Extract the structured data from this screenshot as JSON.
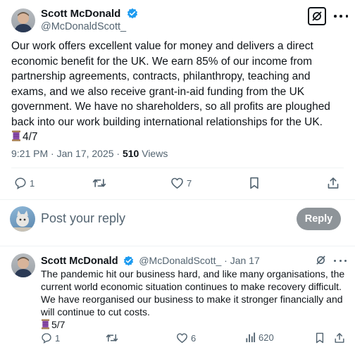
{
  "tweet": {
    "author_name": "Scott McDonald",
    "author_handle": "@McDonaldScott_",
    "body": "Our work offers excellent value for money and delivers a direct economic benefit for the UK. We earn 85% of our income from partnership agreements, contracts, philanthropy, teaching and exams, and we also receive grant-in-aid funding from the UK government. We have no shareholders, so all profits are ploughed back into our work building international relationships for the UK.",
    "thread_counter": "4/7",
    "timestamp": "9:21 PM · Jan 17, 2025 · ",
    "views_count": "510",
    "views_label": " Views",
    "reply_count": "1",
    "retweet_count": "",
    "like_count": "7"
  },
  "composer": {
    "placeholder": "Post your reply",
    "reply_button": "Reply"
  },
  "reply_tweet": {
    "author_name": "Scott McDonald",
    "author_handle": "@McDonaldScott_",
    "date": " · Jan 17",
    "body": "The pandemic hit our business hard, and like many organisations, the current world economic situation continues to make recovery difficult. We have reorganised our business to make it stronger financially and will continue to cut costs.",
    "thread_counter": "5/7",
    "reply_count": "1",
    "like_count": "6",
    "views_count": "620"
  },
  "colors": {
    "verified": "#1d9bf0",
    "secondary_text": "#536471",
    "reply_button_bg": "#8e9499",
    "thread_emoji": "#8a4ca8"
  }
}
